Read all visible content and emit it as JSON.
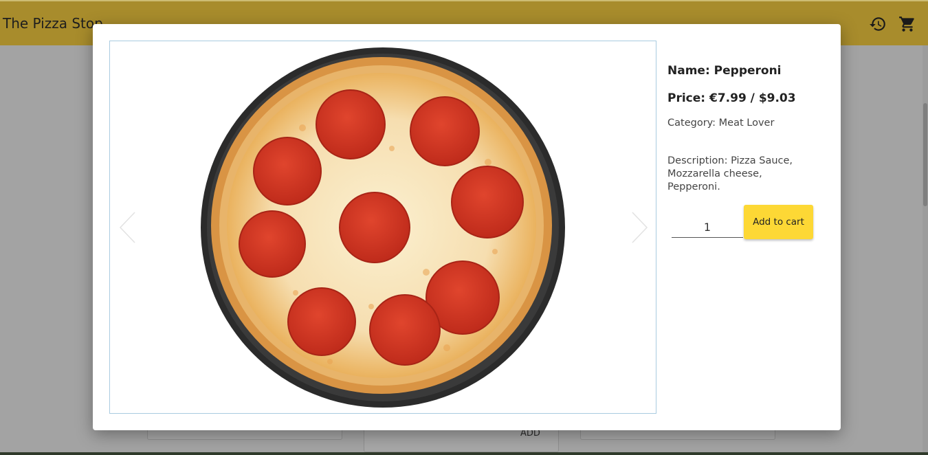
{
  "app": {
    "title": "The Pizza Stop"
  },
  "header_icons": [
    "history-icon",
    "cart-icon"
  ],
  "background": {
    "add_label": "ADD"
  },
  "product": {
    "name": "Name: Pepperoni",
    "price": "Price: €7.99 / $9.03",
    "category": "Category: Meat Lover",
    "description": "Description: Pizza Sauce, Mozzarella cheese, Pepperoni.",
    "quantity": "1",
    "add_to_cart_label": "Add to cart"
  },
  "colors": {
    "appbar": "#a88c2c",
    "button": "#fdd835",
    "carousel_border": "#a9cbe0"
  }
}
